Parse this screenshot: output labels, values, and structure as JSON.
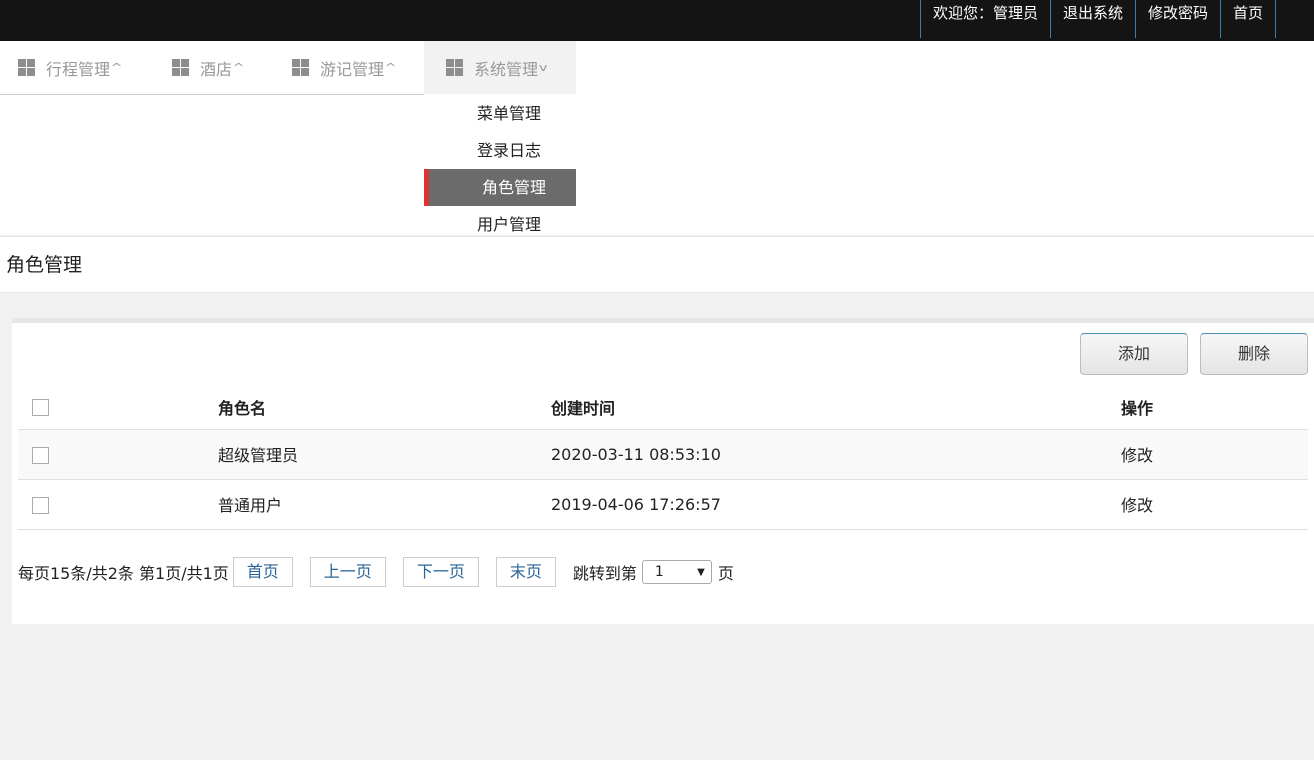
{
  "topbar": {
    "links": [
      "欢迎您：管理员",
      "退出系统",
      "修改密码",
      "首页"
    ]
  },
  "nav": {
    "items": [
      {
        "label": "行程管理",
        "chevron": "^"
      },
      {
        "label": "酒店",
        "chevron": "^"
      },
      {
        "label": "游记管理",
        "chevron": "^"
      },
      {
        "label": "系统管理",
        "chevron": "v"
      }
    ],
    "dropdown": [
      "菜单管理",
      "登录日志",
      "角色管理",
      "用户管理"
    ]
  },
  "page": {
    "title": "角色管理"
  },
  "toolbar": {
    "add_label": "添加",
    "delete_label": "删除"
  },
  "table": {
    "headers": [
      "角色名",
      "创建时间",
      "操作"
    ],
    "rows": [
      {
        "name": "超级管理员",
        "created": "2020-03-11 08:53:10",
        "action": "修改"
      },
      {
        "name": "普通用户",
        "created": "2019-04-06 17:26:57",
        "action": "修改"
      }
    ]
  },
  "pager": {
    "summary": "每页15条/共2条 第1页/共1页",
    "first": "首页",
    "prev": "上一页",
    "next": "下一页",
    "last": "末页",
    "jump_label": "跳转到第",
    "page_value": "1",
    "page_suffix": "页"
  }
}
